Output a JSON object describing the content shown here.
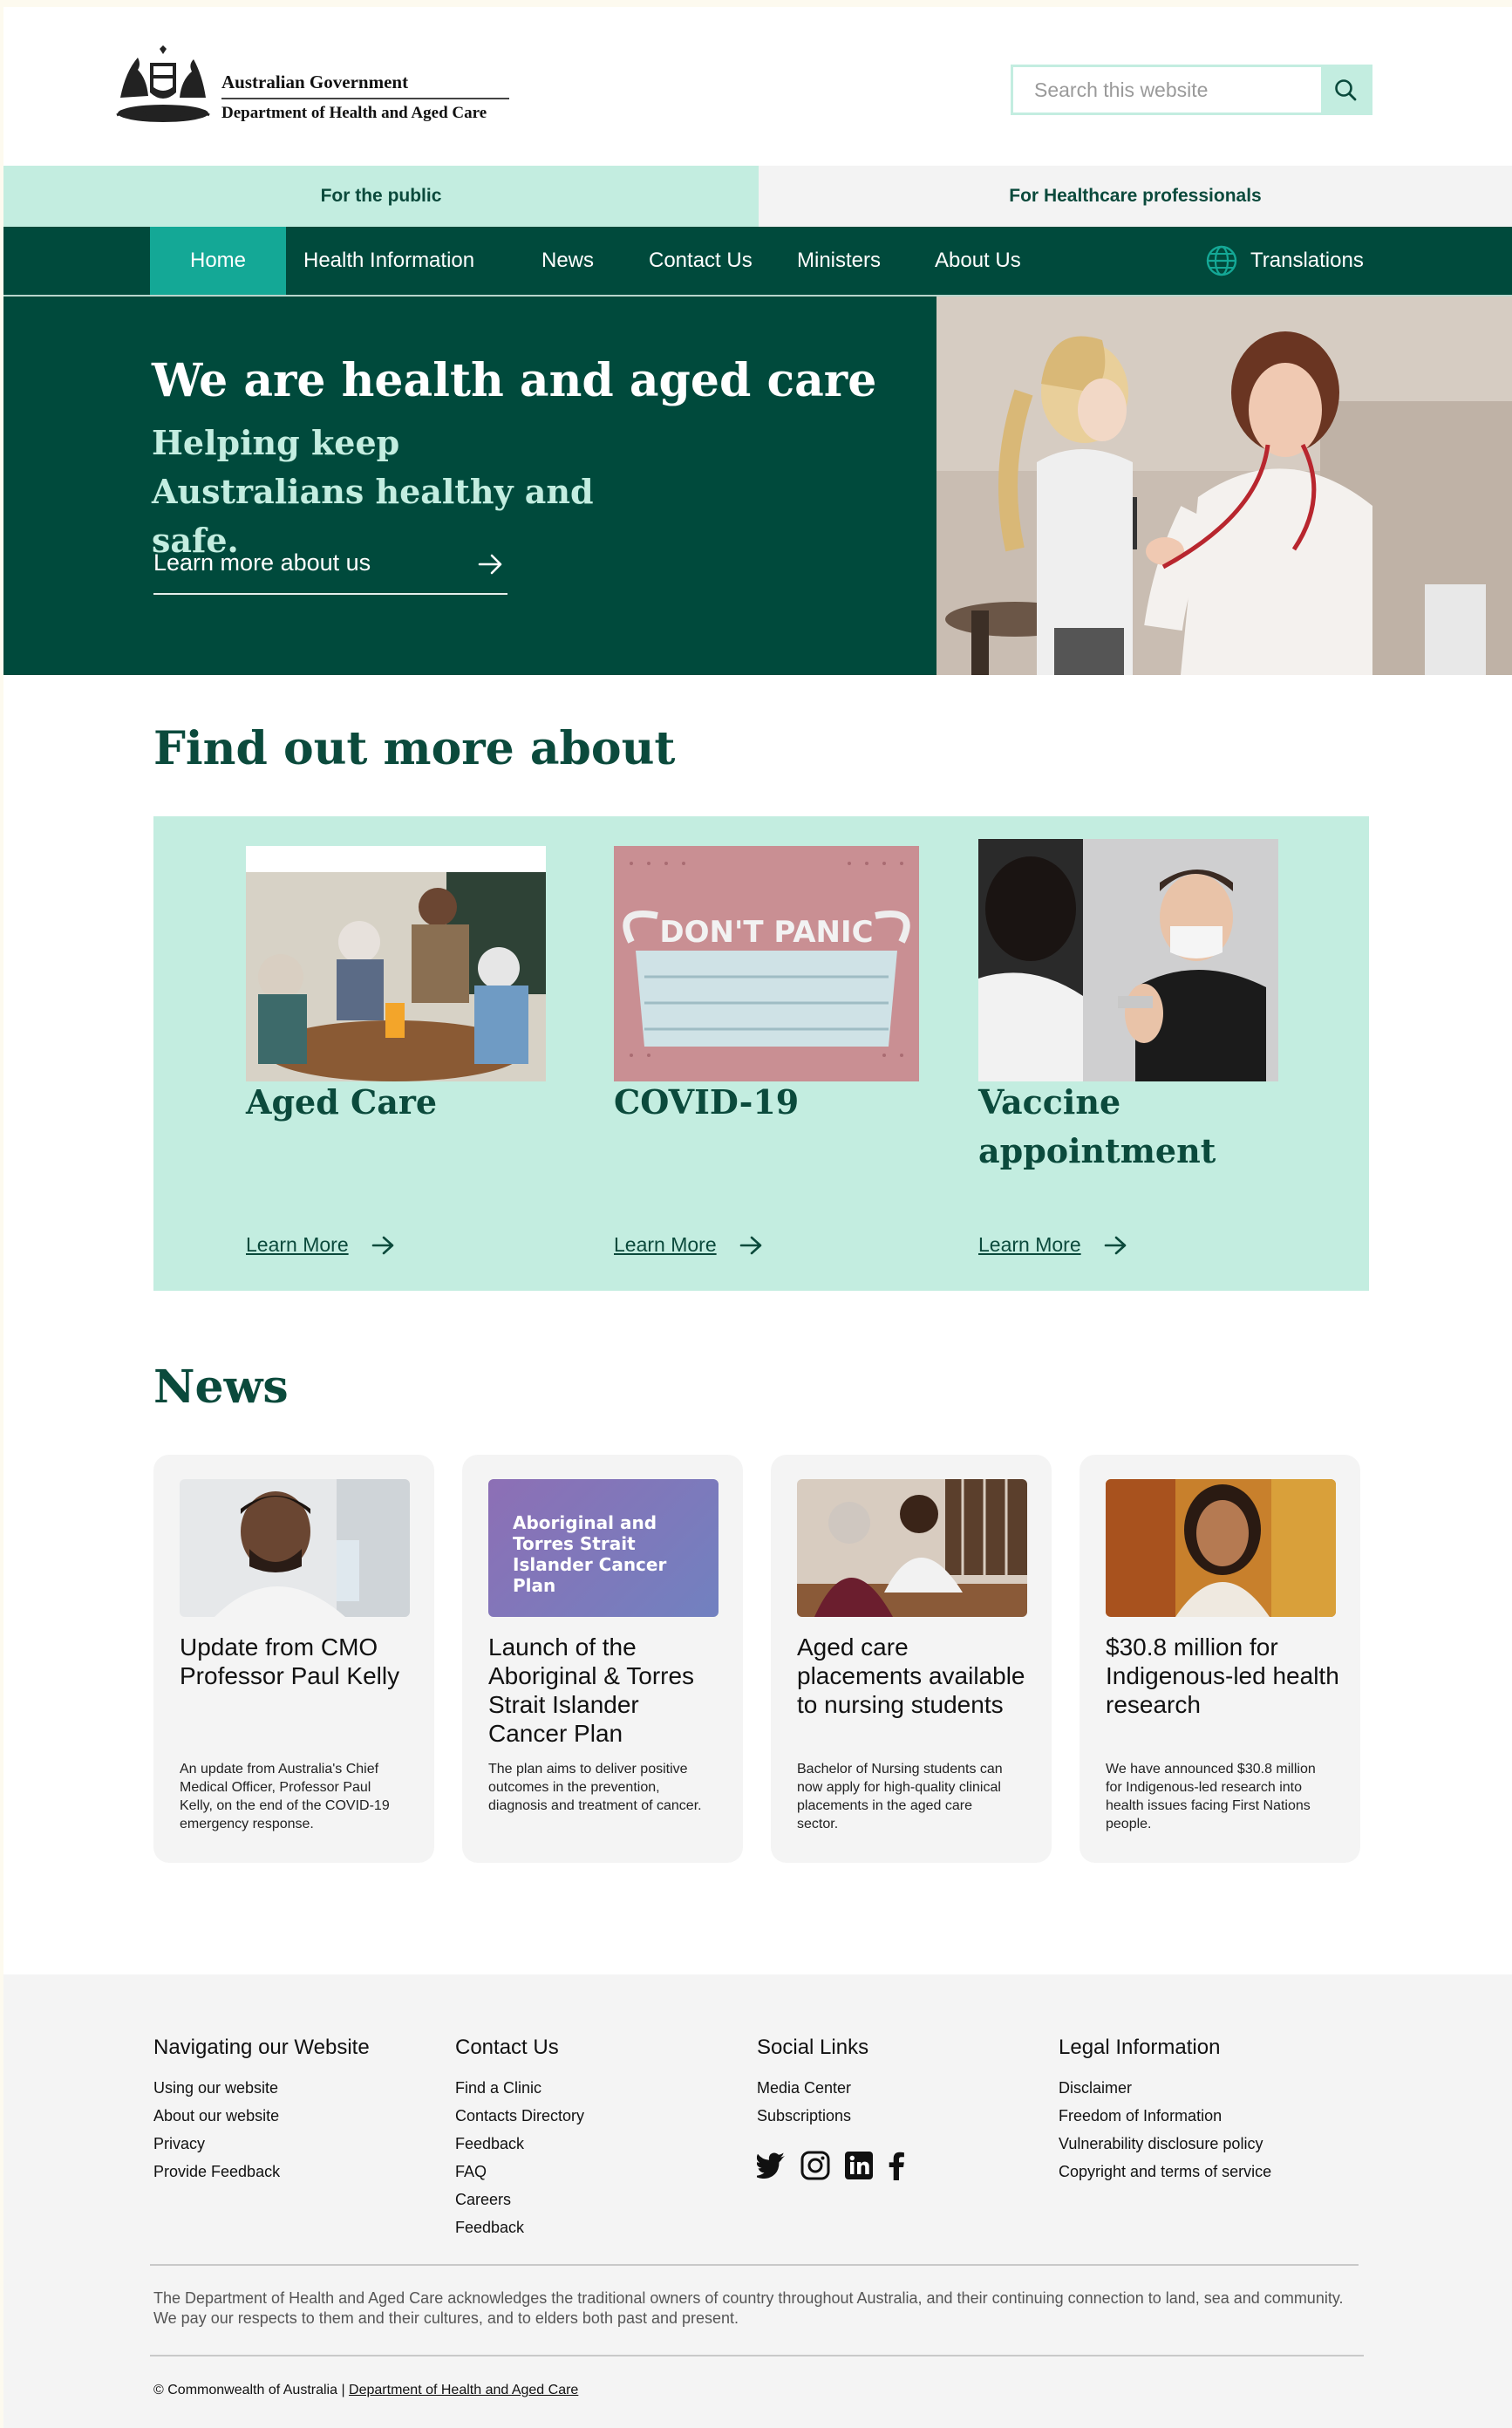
{
  "header": {
    "gov_name": "Australian Government",
    "dept_name": "Department of Health and Aged Care",
    "search_placeholder": "Search this website"
  },
  "audience": {
    "public": "For the public",
    "professionals": "For Healthcare professionals"
  },
  "nav": {
    "items": [
      "Home",
      "Health Information",
      "News",
      "Contact Us",
      "Ministers",
      "About Us"
    ],
    "active": "Home",
    "translations": "Translations"
  },
  "hero": {
    "title": "We are health and aged care",
    "subtitle": "Helping keep Australians healthy and safe.",
    "link": "Learn more about us"
  },
  "find_out_more": {
    "title": "Find out more about",
    "cards": [
      {
        "heading": "Aged Care",
        "link": "Learn More"
      },
      {
        "heading": "COVID-19",
        "link": "Learn More",
        "image_text": "DON'T PANIC"
      },
      {
        "heading": "Vaccine appointment",
        "link": "Learn More"
      }
    ]
  },
  "news": {
    "title": "News",
    "items": [
      {
        "headline": "Update from CMO Professor Paul Kelly",
        "body": "An update from Australia's Chief Medical Officer, Professor Paul Kelly, on the end of the COVID-19 emergency response."
      },
      {
        "headline": "Launch of the Aboriginal & Torres Strait Islander Cancer Plan",
        "body": "The plan aims to deliver positive outcomes in the prevention, diagnosis and treatment of cancer.",
        "image_text": "Aboriginal and Torres Strait Islander Cancer Plan"
      },
      {
        "headline": "Aged care placements available to nursing students",
        "body": "Bachelor of Nursing students can now apply for high-quality clinical placements in the aged care sector."
      },
      {
        "headline": "$30.8 million for Indigenous-led health research",
        "body": "We have announced $30.8 million for Indigenous-led research into health issues facing First Nations people."
      }
    ]
  },
  "footer": {
    "columns": [
      {
        "title": "Navigating our Website",
        "links": [
          "Using our website",
          "About our website",
          "Privacy",
          "Provide Feedback"
        ]
      },
      {
        "title": "Contact Us",
        "links": [
          "Find a Clinic",
          "Contacts Directory",
          "Feedback",
          "FAQ",
          "Careers",
          "Feedback"
        ]
      },
      {
        "title": "Social Links",
        "links": [
          "Media Center",
          "Subscriptions"
        ],
        "social_icons": [
          "twitter-icon",
          "instagram-icon",
          "linkedin-icon",
          "facebook-icon"
        ]
      },
      {
        "title": "Legal Information",
        "links": [
          "Disclaimer",
          "Freedom of Information",
          "Vulnerability disclosure policy",
          "Copyright and terms of service"
        ]
      }
    ],
    "acknowledgement": "The Department of Health and Aged Care acknowledges the traditional owners of country throughout Australia, and their continuing connection to land, sea and community. We pay our respects to them and their cultures, and to elders both past and present.",
    "copyright_prefix": "© Commonwealth of Australia |",
    "copyright_link": "Department of Health and Aged Care"
  },
  "colors": {
    "primary_dark": "#004a3c",
    "mint": "#c3ede0",
    "active_teal": "#14a896",
    "heading_green": "#0b4a3c"
  }
}
